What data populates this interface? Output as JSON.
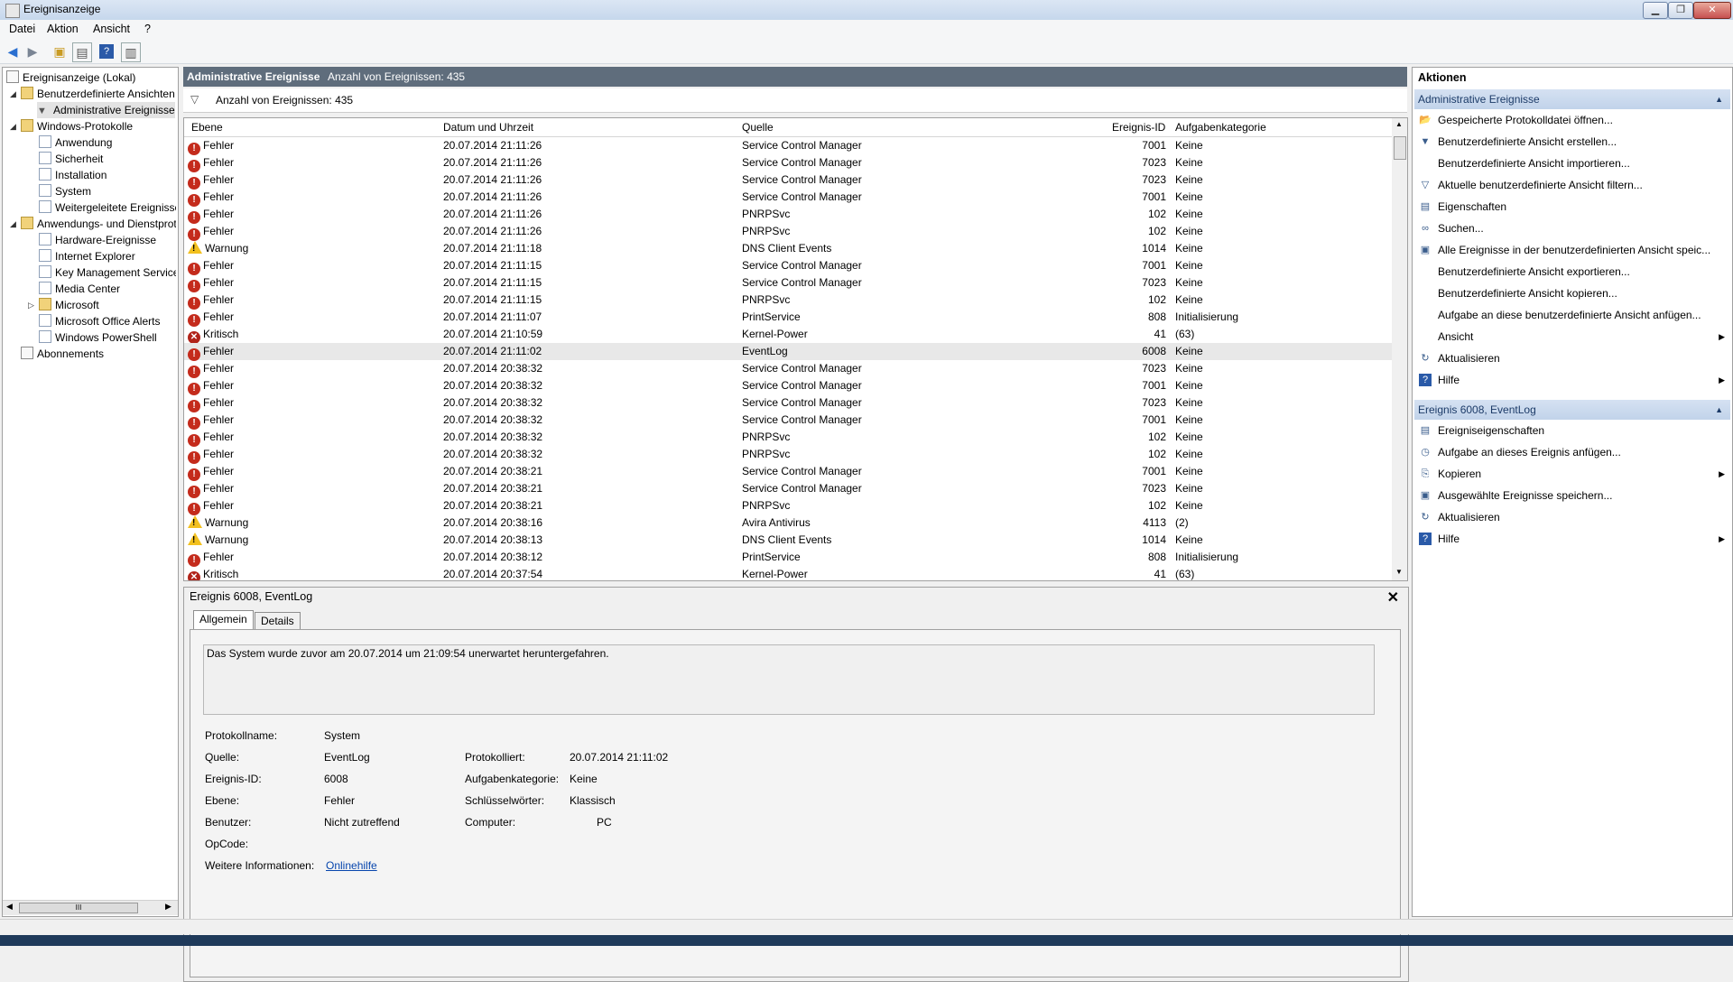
{
  "window": {
    "title": "Ereignisanzeige",
    "btn_min": "▁",
    "btn_max": "❐",
    "btn_close": "✕"
  },
  "menu": {
    "datei": "Datei",
    "aktion": "Aktion",
    "ansicht": "Ansicht",
    "help": "?"
  },
  "toolbar": {
    "back_icon": "back-arrow-icon",
    "forward_icon": "forward-arrow-icon"
  },
  "tree": {
    "root": "Ereignisanzeige (Lokal)",
    "custom_views": "Benutzerdefinierte Ansichten",
    "admin_events": "Administrative Ereignisse",
    "windows_logs": "Windows-Protokolle",
    "anwendung": "Anwendung",
    "sicherheit": "Sicherheit",
    "installation": "Installation",
    "system": "System",
    "forwarded": "Weitergeleitete Ereignisse",
    "app_services": "Anwendungs- und Dienstprotokolle",
    "hardware": "Hardware-Ereignisse",
    "ie": "Internet Explorer",
    "kms": "Key Management Service",
    "media": "Media Center",
    "microsoft": "Microsoft",
    "office_alerts": "Microsoft Office Alerts",
    "powershell": "Windows PowerShell",
    "abos": "Abonnements",
    "hscroll_grip": "III"
  },
  "center": {
    "header_title": "Administrative Ereignisse",
    "header_count": "Anzahl von Ereignissen: 435",
    "filter_count": "Anzahl von Ereignissen: 435",
    "columns": {
      "ebene": "Ebene",
      "datum": "Datum und Uhrzeit",
      "quelle": "Quelle",
      "id": "Ereignis-ID",
      "kategorie": "Aufgabenkategorie"
    }
  },
  "events": [
    {
      "level": "Fehler",
      "type": "error",
      "date": "20.07.2014 21:11:26",
      "source": "Service Control Manager",
      "id": "7001",
      "category": "Keine"
    },
    {
      "level": "Fehler",
      "type": "error",
      "date": "20.07.2014 21:11:26",
      "source": "Service Control Manager",
      "id": "7023",
      "category": "Keine"
    },
    {
      "level": "Fehler",
      "type": "error",
      "date": "20.07.2014 21:11:26",
      "source": "Service Control Manager",
      "id": "7023",
      "category": "Keine"
    },
    {
      "level": "Fehler",
      "type": "error",
      "date": "20.07.2014 21:11:26",
      "source": "Service Control Manager",
      "id": "7001",
      "category": "Keine"
    },
    {
      "level": "Fehler",
      "type": "error",
      "date": "20.07.2014 21:11:26",
      "source": "PNRPSvc",
      "id": "102",
      "category": "Keine"
    },
    {
      "level": "Fehler",
      "type": "error",
      "date": "20.07.2014 21:11:26",
      "source": "PNRPSvc",
      "id": "102",
      "category": "Keine"
    },
    {
      "level": "Warnung",
      "type": "warn",
      "date": "20.07.2014 21:11:18",
      "source": "DNS Client Events",
      "id": "1014",
      "category": "Keine"
    },
    {
      "level": "Fehler",
      "type": "error",
      "date": "20.07.2014 21:11:15",
      "source": "Service Control Manager",
      "id": "7001",
      "category": "Keine"
    },
    {
      "level": "Fehler",
      "type": "error",
      "date": "20.07.2014 21:11:15",
      "source": "Service Control Manager",
      "id": "7023",
      "category": "Keine"
    },
    {
      "level": "Fehler",
      "type": "error",
      "date": "20.07.2014 21:11:15",
      "source": "PNRPSvc",
      "id": "102",
      "category": "Keine"
    },
    {
      "level": "Fehler",
      "type": "error",
      "date": "20.07.2014 21:11:07",
      "source": "PrintService",
      "id": "808",
      "category": "Initialisierung"
    },
    {
      "level": "Kritisch",
      "type": "crit",
      "date": "20.07.2014 21:10:59",
      "source": "Kernel-Power",
      "id": "41",
      "category": "(63)"
    },
    {
      "level": "Fehler",
      "type": "error",
      "date": "20.07.2014 21:11:02",
      "source": "EventLog",
      "id": "6008",
      "category": "Keine"
    },
    {
      "level": "Fehler",
      "type": "error",
      "date": "20.07.2014 20:38:32",
      "source": "Service Control Manager",
      "id": "7023",
      "category": "Keine"
    },
    {
      "level": "Fehler",
      "type": "error",
      "date": "20.07.2014 20:38:32",
      "source": "Service Control Manager",
      "id": "7001",
      "category": "Keine"
    },
    {
      "level": "Fehler",
      "type": "error",
      "date": "20.07.2014 20:38:32",
      "source": "Service Control Manager",
      "id": "7023",
      "category": "Keine"
    },
    {
      "level": "Fehler",
      "type": "error",
      "date": "20.07.2014 20:38:32",
      "source": "Service Control Manager",
      "id": "7001",
      "category": "Keine"
    },
    {
      "level": "Fehler",
      "type": "error",
      "date": "20.07.2014 20:38:32",
      "source": "PNRPSvc",
      "id": "102",
      "category": "Keine"
    },
    {
      "level": "Fehler",
      "type": "error",
      "date": "20.07.2014 20:38:32",
      "source": "PNRPSvc",
      "id": "102",
      "category": "Keine"
    },
    {
      "level": "Fehler",
      "type": "error",
      "date": "20.07.2014 20:38:21",
      "source": "Service Control Manager",
      "id": "7001",
      "category": "Keine"
    },
    {
      "level": "Fehler",
      "type": "error",
      "date": "20.07.2014 20:38:21",
      "source": "Service Control Manager",
      "id": "7023",
      "category": "Keine"
    },
    {
      "level": "Fehler",
      "type": "error",
      "date": "20.07.2014 20:38:21",
      "source": "PNRPSvc",
      "id": "102",
      "category": "Keine"
    },
    {
      "level": "Warnung",
      "type": "warn",
      "date": "20.07.2014 20:38:16",
      "source": "Avira Antivirus",
      "id": "4113",
      "category": "(2)"
    },
    {
      "level": "Warnung",
      "type": "warn",
      "date": "20.07.2014 20:38:13",
      "source": "DNS Client Events",
      "id": "1014",
      "category": "Keine"
    },
    {
      "level": "Fehler",
      "type": "error",
      "date": "20.07.2014 20:38:12",
      "source": "PrintService",
      "id": "808",
      "category": "Initialisierung"
    },
    {
      "level": "Kritisch",
      "type": "crit",
      "date": "20.07.2014 20:37:54",
      "source": "Kernel-Power",
      "id": "41",
      "category": "(63)"
    }
  ],
  "selected_row_index": 12,
  "detail": {
    "title": "Ereignis 6008, EventLog",
    "close": "✕",
    "tab_general": "Allgemein",
    "tab_details": "Details",
    "description": "Das System wurde zuvor am 20.07.2014 um 21:09:54 unerwartet heruntergefahren.",
    "lbl_logname": "Protokollname:",
    "val_logname": "System",
    "lbl_source": "Quelle:",
    "val_source": "EventLog",
    "lbl_logged": "Protokolliert:",
    "val_logged": "20.07.2014 21:11:02",
    "lbl_eventid": "Ereignis-ID:",
    "val_eventid": "6008",
    "lbl_taskcat": "Aufgabenkategorie:",
    "val_taskcat": "Keine",
    "lbl_level": "Ebene:",
    "val_level": "Fehler",
    "lbl_keywords": "Schlüsselwörter:",
    "val_keywords": "Klassisch",
    "lbl_user": "Benutzer:",
    "val_user": "Nicht zutreffend",
    "lbl_computer": "Computer:",
    "val_computer": "PC",
    "lbl_opcode": "OpCode:",
    "lbl_moreinfo": "Weitere Informationen:",
    "val_moreinfo": "Onlinehilfe"
  },
  "actions": {
    "title": "Aktionen",
    "group1": "Administrative Ereignisse",
    "group1_items": [
      {
        "label": "Gespeicherte Protokolldatei öffnen...",
        "icon": "open-folder-icon"
      },
      {
        "label": "Benutzerdefinierte Ansicht erstellen...",
        "icon": "filter-create-icon"
      },
      {
        "label": "Benutzerdefinierte Ansicht importieren...",
        "icon": ""
      },
      {
        "label": "Aktuelle benutzerdefinierte Ansicht filtern...",
        "icon": "filter-icon"
      },
      {
        "label": "Eigenschaften",
        "icon": "properties-icon"
      },
      {
        "label": "Suchen...",
        "icon": "binoculars-icon"
      },
      {
        "label": "Alle Ereignisse in der benutzerdefinierten Ansicht speic...",
        "icon": "save-icon"
      },
      {
        "label": "Benutzerdefinierte Ansicht exportieren...",
        "icon": ""
      },
      {
        "label": "Benutzerdefinierte Ansicht kopieren...",
        "icon": ""
      },
      {
        "label": "Aufgabe an diese benutzerdefinierte Ansicht anfügen...",
        "icon": ""
      },
      {
        "label": "Ansicht",
        "icon": "",
        "submenu": true
      },
      {
        "label": "Aktualisieren",
        "icon": "refresh-icon"
      },
      {
        "label": "Hilfe",
        "icon": "help-icon",
        "submenu": true
      }
    ],
    "group2": "Ereignis 6008, EventLog",
    "group2_items": [
      {
        "label": "Ereigniseigenschaften",
        "icon": "properties-icon"
      },
      {
        "label": "Aufgabe an dieses Ereignis anfügen...",
        "icon": "task-icon"
      },
      {
        "label": "Kopieren",
        "icon": "copy-icon",
        "submenu": true
      },
      {
        "label": "Ausgewählte Ereignisse speichern...",
        "icon": "save-icon"
      },
      {
        "label": "Aktualisieren",
        "icon": "refresh-icon"
      },
      {
        "label": "Hilfe",
        "icon": "help-icon",
        "submenu": true
      }
    ]
  }
}
